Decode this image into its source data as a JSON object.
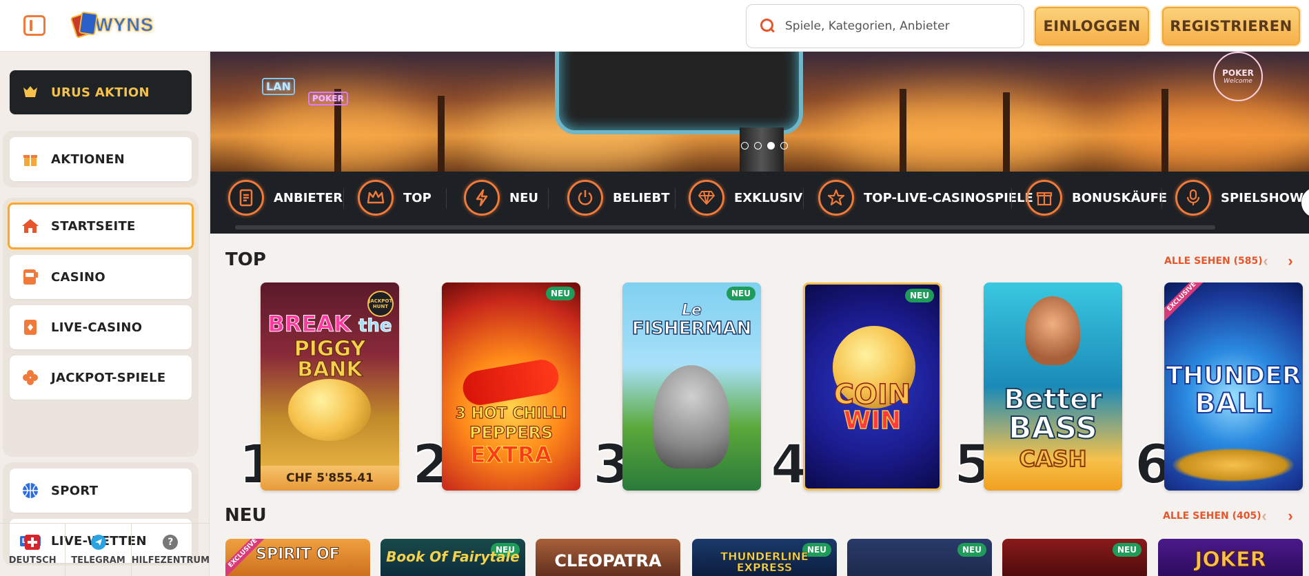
{
  "header": {
    "logo_text": "WYNS",
    "search_placeholder": "Spiele, Kategorien, Anbieter",
    "login_label": "EINLOGGEN",
    "register_label": "REGISTRIEREN"
  },
  "sidebar": {
    "items": [
      {
        "label": "URUS AKTION",
        "icon": "bull-icon"
      },
      {
        "label": "AKTIONEN",
        "icon": "gift-icon"
      },
      {
        "label": "STARTSEITE",
        "icon": "home-icon"
      },
      {
        "label": "CASINO",
        "icon": "slot-machine-icon"
      },
      {
        "label": "LIVE-CASINO",
        "icon": "card-icon"
      },
      {
        "label": "JACKPOT-SPIELE",
        "icon": "clover-icon"
      },
      {
        "label": "SPORT",
        "icon": "basketball-icon"
      },
      {
        "label": "LIVE-WETTEN",
        "icon": "live-badge-icon",
        "badge": "LIVE"
      }
    ],
    "footer": [
      {
        "label": "DEUTSCH",
        "icon": "swiss-flag-icon"
      },
      {
        "label": "TELEGRAM",
        "icon": "telegram-icon"
      },
      {
        "label": "HILFEZENTRUM",
        "icon": "help-icon",
        "glyph": "?"
      }
    ]
  },
  "hero": {
    "neon_left": "LAN",
    "neon_poker": "POKER",
    "poker_sign": "POKER",
    "poker_sign_sub": "Welcome",
    "dots": 4,
    "active_dot": 3
  },
  "categories": [
    {
      "label": "ANBIETER",
      "icon": "document-icon"
    },
    {
      "label": "TOP",
      "icon": "crown-icon"
    },
    {
      "label": "NEU",
      "icon": "lightning-icon"
    },
    {
      "label": "BELIEBT",
      "icon": "power-icon"
    },
    {
      "label": "EXKLUSIV",
      "icon": "diamond-icon"
    },
    {
      "label": "TOP-LIVE-CASINOSPIELE",
      "icon": "star-icon"
    },
    {
      "label": "BONUSKÄUFE",
      "icon": "gift-icon"
    },
    {
      "label": "SPIELSHOWS",
      "icon": "microphone-icon"
    }
  ],
  "top_section": {
    "title": "TOP",
    "see_all": "ALLE SEHEN (585)",
    "games": [
      {
        "rank": "1",
        "title_line1": "BREAK",
        "title_line1b": "the",
        "title_line2": "PIGGY BANK",
        "badge": "JACKPOT HUNT",
        "jackpot": "CHF 5'855.41"
      },
      {
        "rank": "2",
        "title_line1": "3 HOT CHILLI",
        "title_line2": "PEPPERS",
        "title_line3": "EXTRA",
        "badge": "NEU"
      },
      {
        "rank": "3",
        "title_line1": "Le",
        "title_line2": "FISHERMAN",
        "badge": "NEU"
      },
      {
        "rank": "4",
        "title_line1": "COIN",
        "title_line2": "WIN",
        "badge": "NEU"
      },
      {
        "rank": "5",
        "title_line1": "Better",
        "title_line2": "BASS",
        "title_line3": "CASH"
      },
      {
        "rank": "6",
        "title_line1": "THUNDER",
        "title_line2": "BALL",
        "badge": "EXCLUSIVE"
      }
    ]
  },
  "neu_section": {
    "title": "NEU",
    "see_all": "ALLE SEHEN (405)",
    "games": [
      {
        "title": "SPIRIT OF",
        "badge": "EXCLUSIVE"
      },
      {
        "title": "Book Of Fairytale",
        "badge": "NEU"
      },
      {
        "title": "CLEOPATRA"
      },
      {
        "title": "THUNDERLINE EXPRESS",
        "badge": "NEU"
      },
      {
        "title": "",
        "badge": "NEU"
      },
      {
        "title": "",
        "badge": "NEU"
      },
      {
        "title": "JOKER"
      }
    ]
  },
  "colors": {
    "accent": "#e8552a",
    "gold": "#f6b04a",
    "dark": "#1d2024",
    "neu_badge": "#1f9b5a"
  }
}
